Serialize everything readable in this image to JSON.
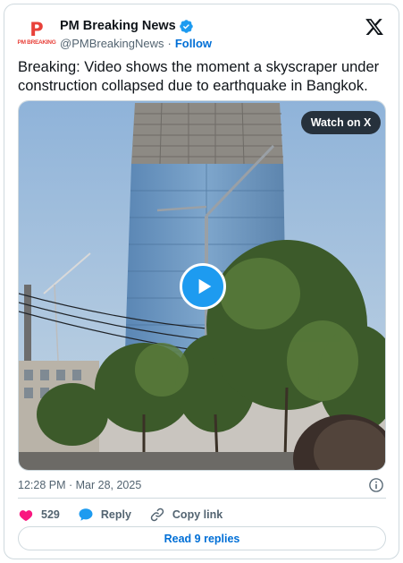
{
  "account": {
    "avatar_logo_letter": "P",
    "avatar_logo_text": "PM BREAKING",
    "name": "PM Breaking News",
    "handle": "@PMBreakingNews",
    "separator": "·",
    "follow_label": "Follow",
    "verified": true
  },
  "tweet": {
    "text": "Breaking: Video shows the moment a skyscraper under construction collapsed due to earthquake in Bangkok."
  },
  "media": {
    "type": "video",
    "watch_label": "Watch on X"
  },
  "meta": {
    "timestamp": "12:28 PM · Mar 28, 2025"
  },
  "actions": {
    "like_count": "529",
    "reply_label": "Reply",
    "copy_link_label": "Copy link"
  },
  "footer": {
    "read_replies_label": "Read 9 replies"
  },
  "colors": {
    "accent": "#1d9bf0",
    "like": "#f91880",
    "link": "#006fd6",
    "muted": "#536471",
    "border": "#cfd9de"
  },
  "icons": [
    "verified-badge-icon",
    "x-logo-icon",
    "play-icon",
    "info-icon",
    "heart-icon",
    "reply-bubble-icon",
    "link-icon"
  ]
}
